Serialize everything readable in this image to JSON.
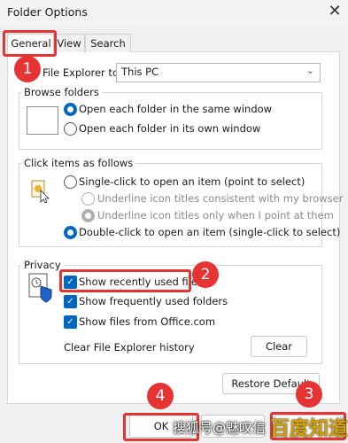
{
  "window": {
    "title": "Folder Options",
    "close_glyph": "✕"
  },
  "tabs": [
    {
      "label": "General"
    },
    {
      "label": "View"
    },
    {
      "label": "Search"
    }
  ],
  "open_fe": {
    "label": "File Explorer to:",
    "value": "This PC"
  },
  "browse": {
    "legend": "Browse folders",
    "option_same": "Open each folder in the same window",
    "option_own": "Open each folder in its own window",
    "selected": "option_same"
  },
  "click": {
    "legend": "Click items as follows",
    "single": "Single-click to open an item (point to select)",
    "underline_browser": "Underline icon titles consistent with my browser",
    "underline_point": "Underline icon titles only when I point at them",
    "double": "Double-click to open an item (single-click to select)",
    "selected": "double"
  },
  "privacy": {
    "legend": "Privacy",
    "recent_files": "Show recently used files",
    "frequent_folders": "Show frequently used folders",
    "office_files": "Show files from Office.com",
    "clear_history_label": "Clear File Explorer history",
    "clear_button": "Clear"
  },
  "restore_button": "Restore Default",
  "ok_button": "OK",
  "annotations": {
    "b1": "1",
    "b2": "2",
    "b3": "3",
    "b4": "4"
  },
  "watermark": {
    "text1": "搜狐号@魅叹信",
    "text2": "百度知道"
  },
  "colors": {
    "accent": "#0067c0",
    "annotation_red": "#e63434"
  }
}
